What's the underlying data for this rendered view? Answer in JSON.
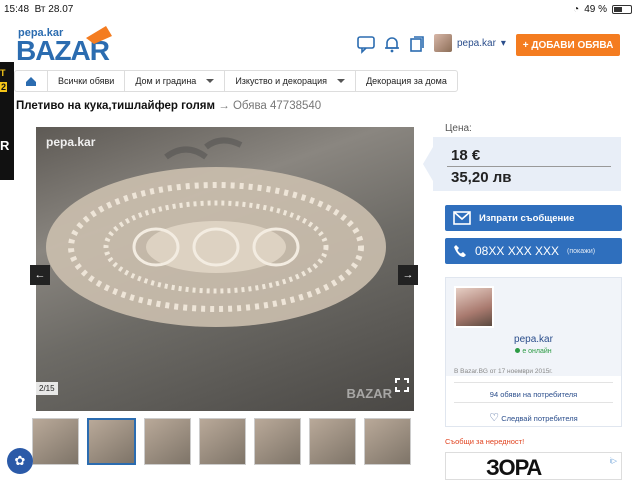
{
  "status_bar": {
    "time": "15:48",
    "date": "Вт 28.07",
    "battery": "49 %",
    "battery_level": 0.49
  },
  "header": {
    "logo_text": "pepa.kar",
    "logo_brand": "BAZAR",
    "user_name": "pepa.kar",
    "add_button": "+ ДОБАВИ ОБЯВА"
  },
  "breadcrumbs": [
    {
      "label": "Всички обяви",
      "dropdown": false
    },
    {
      "label": "Дом и градина",
      "dropdown": true
    },
    {
      "label": "Изкуство и декорация",
      "dropdown": true
    },
    {
      "label": "Декорация за дома",
      "dropdown": false
    }
  ],
  "listing": {
    "title": "Плетиво на кука,тишлайфер голям",
    "arrow": "→",
    "ad_number": "Обява 47738540"
  },
  "gallery": {
    "watermark": "pepa.kar",
    "watermark_brand": "BAZAR",
    "counter": "2/15",
    "thumb_count": 7,
    "selected_thumb": 1
  },
  "price": {
    "label": "Цена:",
    "eur": "18 €",
    "bgn": "35,20 лв"
  },
  "actions": {
    "message": "Изпрати съобщение",
    "phone": "08XX XXX XXX",
    "phone_hint": "(покажи)"
  },
  "seller": {
    "name": "pepa.kar",
    "status": "е онлайн",
    "since": "В Bazar.BG от 17 ноември 2015г.",
    "ads": "94 обяви на потребителя",
    "follow": "Следвай потребителя"
  },
  "report": "Съобщи за нередност!",
  "ad_banner": {
    "brand": "ЗОРА",
    "badge": "i▷"
  },
  "side_ad": {
    "line1": "T",
    "line2": "2",
    "line3": "R"
  }
}
